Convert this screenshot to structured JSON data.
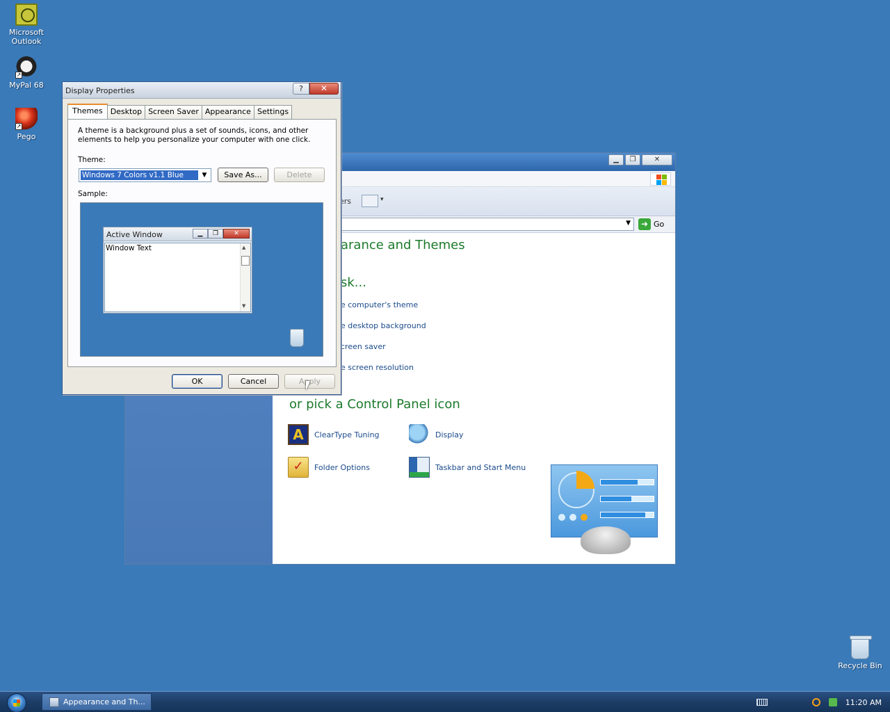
{
  "desktop": {
    "icons": [
      {
        "label": "Microsoft Outlook"
      },
      {
        "label": "MyPal 68"
      },
      {
        "label": "Pego"
      }
    ],
    "recycle_bin": {
      "label": "Recycle Bin"
    }
  },
  "control_panel": {
    "toolbar_folders_label": "ers",
    "go_label": "Go",
    "heading": "arance and Themes",
    "pick_task": "sk...",
    "tasks": [
      "e computer's theme",
      "e desktop background",
      "creen saver",
      "e screen resolution"
    ],
    "pick_icon": "or pick a Control Panel icon",
    "icons": [
      {
        "label": "ClearType Tuning",
        "icon": "cleartype-icon"
      },
      {
        "label": "Display",
        "icon": "display-icon"
      },
      {
        "label": "Folder Options",
        "icon": "folder-options-icon"
      },
      {
        "label": "Taskbar and Start Menu",
        "icon": "taskbar-icon"
      }
    ]
  },
  "dialog": {
    "title": "Display Properties",
    "help_label": "?",
    "close_label": "✕",
    "tabs": [
      "Themes",
      "Desktop",
      "Screen Saver",
      "Appearance",
      "Settings"
    ],
    "active_tab": "Themes",
    "description": "A theme is a background plus a set of sounds, icons, and other elements to help you personalize your computer with one click.",
    "theme_label": "Theme:",
    "theme_value": "Windows 7 Colors v1.1 Blue",
    "save_as_label": "Save As...",
    "delete_label": "Delete",
    "sample_label": "Sample:",
    "sample": {
      "window_title": "Active Window",
      "window_text": "Window Text"
    },
    "ok_label": "OK",
    "cancel_label": "Cancel",
    "apply_label": "Apply"
  },
  "taskbar": {
    "task_label": "Appearance and Th...",
    "clock": "11:20 AM"
  },
  "colors": {
    "desktop": "#3a7ab8",
    "cp_heading": "#1c7a2b",
    "cp_link": "#1a4a8a",
    "selection": "#316ac5",
    "active_tab_accent": "#e68b2c"
  }
}
